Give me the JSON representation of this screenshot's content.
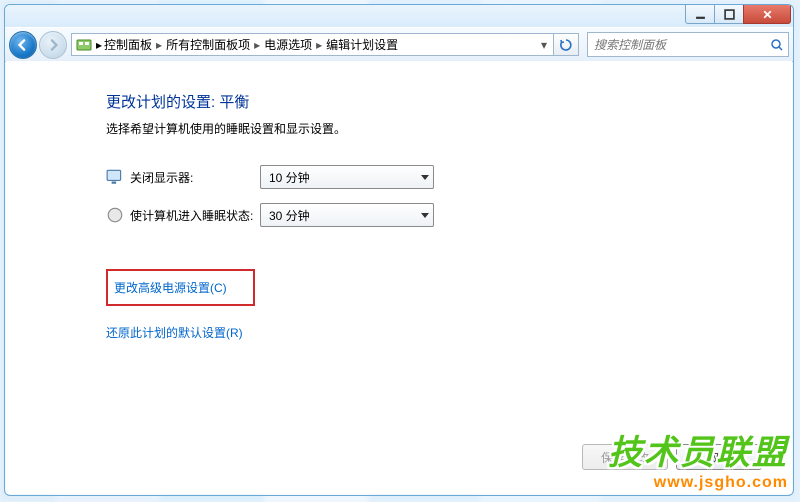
{
  "breadcrumb": {
    "items": [
      "控制面板",
      "所有控制面板项",
      "电源选项",
      "编辑计划设置"
    ]
  },
  "search": {
    "placeholder": "搜索控制面板"
  },
  "page": {
    "title": "更改计划的设置: 平衡",
    "subtitle": "选择希望计算机使用的睡眠设置和显示设置。"
  },
  "settings": {
    "display_off": {
      "label": "关闭显示器:",
      "value": "10 分钟"
    },
    "sleep": {
      "label": "使计算机进入睡眠状态:",
      "value": "30 分钟"
    }
  },
  "links": {
    "advanced": "更改高级电源设置(C)",
    "restore": "还原此计划的默认设置(R)"
  },
  "buttons": {
    "save": "保存修改",
    "cancel": "取消"
  },
  "watermark": {
    "brand": "技术员联盟",
    "url": "www.jsgho.com"
  }
}
